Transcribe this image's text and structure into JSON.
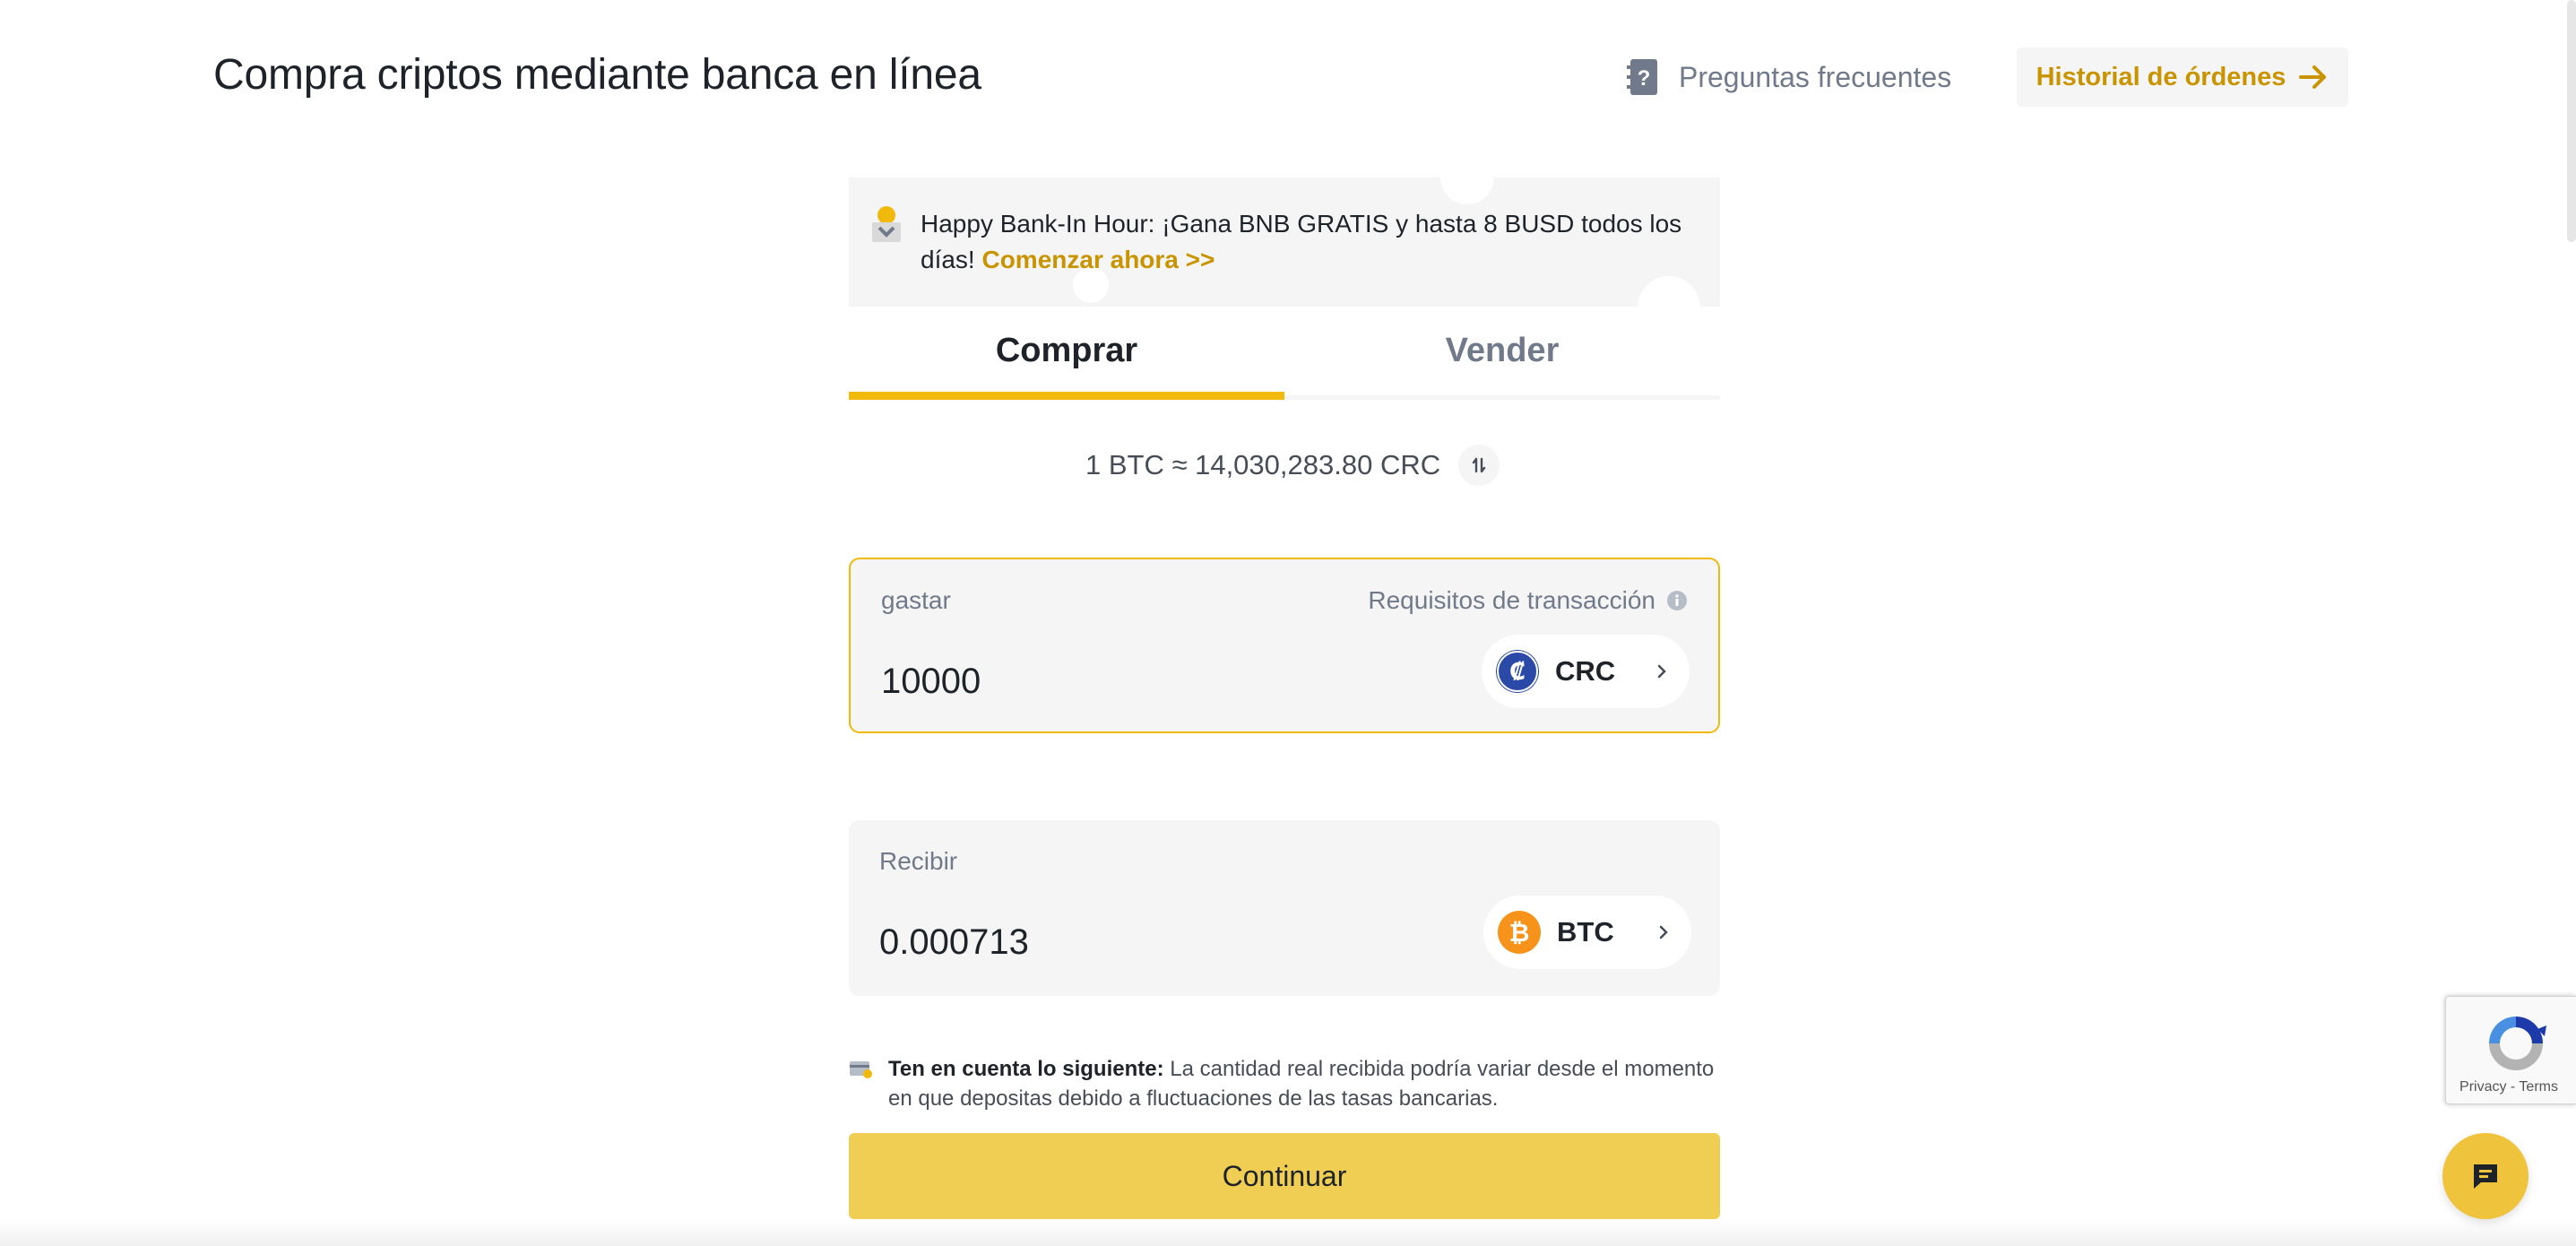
{
  "header": {
    "title": "Compra criptos mediante banca en línea",
    "faq_label": "Preguntas frecuentes",
    "faq_icon": "faq-book-icon",
    "history_label": "Historial de órdenes",
    "history_icon": "arrow-right-icon"
  },
  "banner": {
    "icon": "gift-box-icon",
    "text": "Happy Bank-In Hour: ¡Gana BNB GRATIS y hasta 8 BUSD todos los días! ",
    "link_label": "Comenzar ahora >>"
  },
  "tabs": [
    {
      "label": "Comprar",
      "active": true
    },
    {
      "label": "Vender",
      "active": false
    }
  ],
  "rate": {
    "text": "1 BTC ≈ 14,030,283.80 CRC",
    "icon": "swap-icon"
  },
  "spend": {
    "label": "gastar",
    "requirements_label": "Requisitos de transacción",
    "requirements_icon": "info-icon",
    "value": "10000",
    "currency_code": "CRC",
    "currency_icon": "colon-coin-icon",
    "currency_color": "#2b4aa8"
  },
  "receive": {
    "label": "Recibir",
    "value": "0.000713",
    "currency_code": "BTC",
    "currency_icon": "bitcoin-icon",
    "currency_color": "#f7931a"
  },
  "note": {
    "icon": "card-note-icon",
    "strong": "Ten en cuenta lo siguiente:",
    "text": " La cantidad real recibida podría variar desde el momento en que depositas debido a fluctuaciones de las tasas bancarias."
  },
  "continue_label": "Continuar",
  "recaptcha": {
    "text": "Privacy - Terms",
    "icon": "recaptcha-icon"
  },
  "chat": {
    "icon": "chat-icon"
  },
  "colors": {
    "accent": "#f0b90b",
    "link": "#c99400",
    "button": "#f0ce53",
    "panel": "#f5f5f5"
  }
}
